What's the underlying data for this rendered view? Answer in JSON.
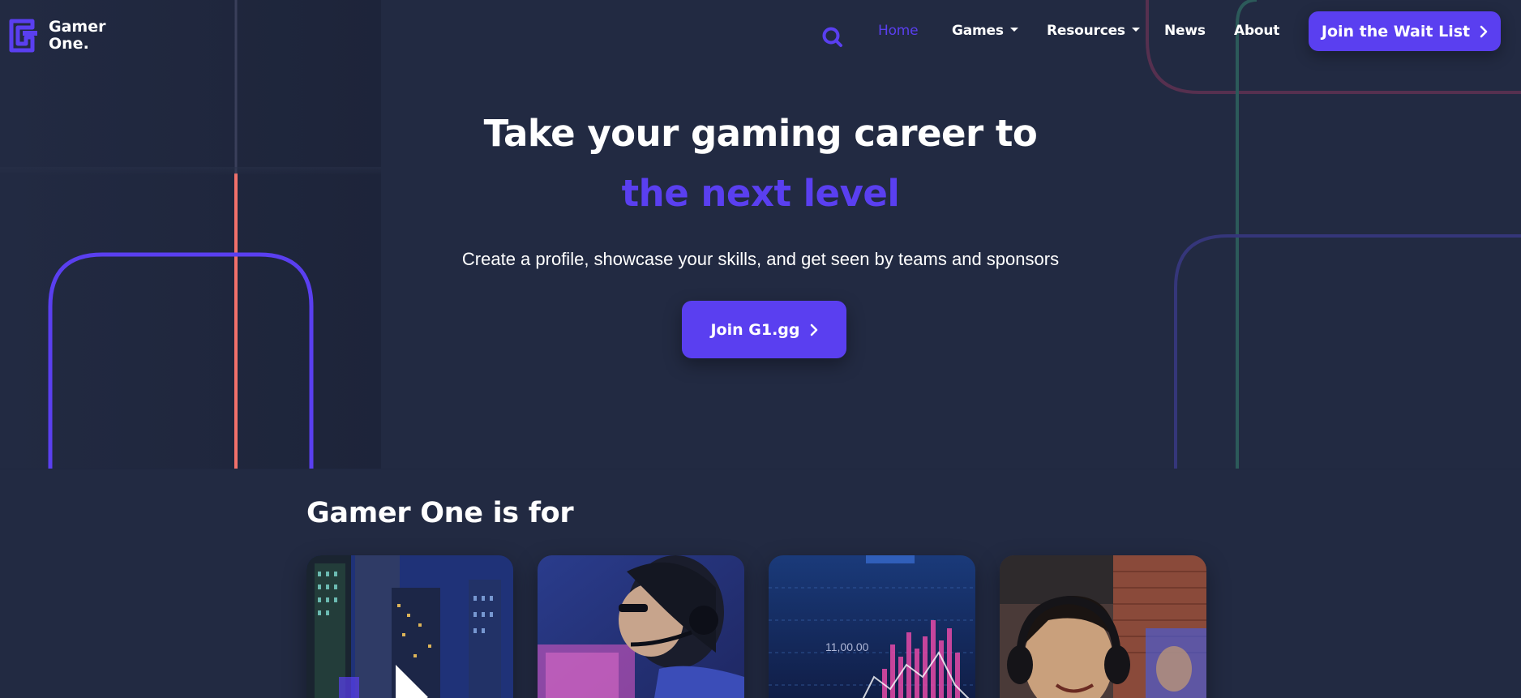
{
  "header": {
    "logo_text": "Gamer\nOne.",
    "nav": [
      {
        "label": "Home",
        "active": true
      },
      {
        "label": "Games",
        "dropdown": true
      },
      {
        "label": "Resources",
        "dropdown": true
      },
      {
        "label": "News"
      },
      {
        "label": "About"
      }
    ],
    "cta_label": "Join the Wait List"
  },
  "hero": {
    "title": "Take your gaming career to",
    "accent": "the next level",
    "subtitle": "Create a profile, showcase your skills, and get seen by teams and sponsors",
    "cta_label": "Join G1.gg"
  },
  "audience": {
    "title": "Gamer One is for",
    "card_price_label": "11,00.00"
  },
  "colors": {
    "background": "#222a42",
    "accent": "#5a3ff0",
    "coral_line": "#f2716b",
    "magenta_line": "#5b2e4f",
    "teal_line": "#2c5a5a"
  },
  "icons": {
    "search": "search-icon",
    "chevron": "chevron-right-icon",
    "caret": "caret-down-icon"
  }
}
